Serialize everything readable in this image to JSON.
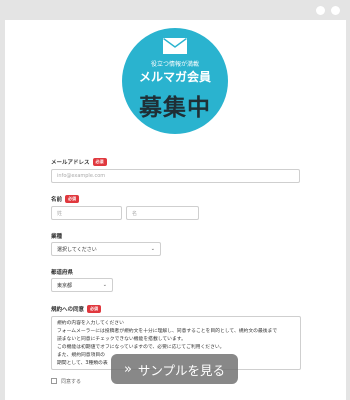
{
  "badge": {
    "subtitle": "役立つ情報が満載",
    "title": "メルマガ会員",
    "main": "募集中"
  },
  "form": {
    "required_label": "必須",
    "email": {
      "label": "メールアドレス",
      "placeholder": "info@example.com"
    },
    "name": {
      "label": "名前",
      "last_placeholder": "姓",
      "first_placeholder": "名"
    },
    "occupation": {
      "label": "業種",
      "value": "選択してください"
    },
    "prefecture": {
      "label": "都道府県",
      "value": "東京都"
    },
    "terms": {
      "label": "規約への同意",
      "lines": [
        "規約の内容を入力してください",
        "フォームメーラーには投稿者が規約文を十分に理解し、同意することを目的として、規約文の最後まで",
        "読まないと同意にチェックできない機能を搭載しています。",
        "この機能は初期値でオフになっていますので、必要に応じてご利用ください。",
        "また、規約同意項目の",
        "期間として、3種類の表"
      ],
      "agree_label": "同意する"
    }
  },
  "overlay": {
    "sample_button": "サンプルを見る",
    "icon": "double-chevron-right-icon"
  }
}
